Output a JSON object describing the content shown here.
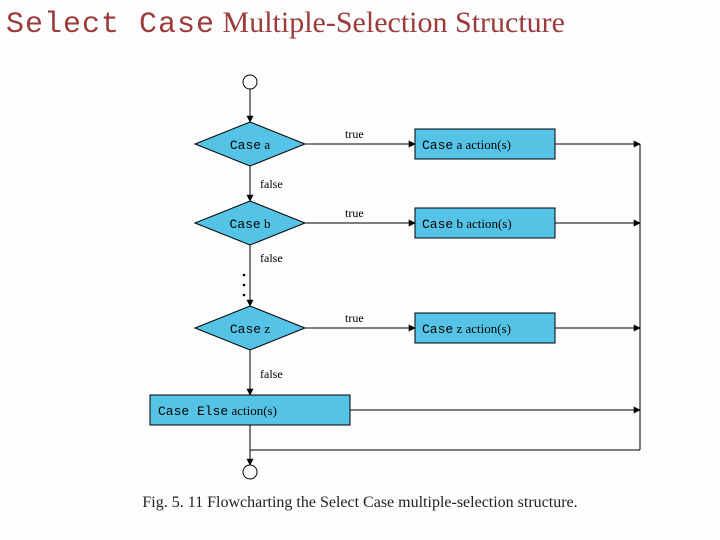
{
  "title": {
    "keyword": "Select Case",
    "rest": " Multiple-Selection Structure"
  },
  "labels": {
    "true": "true",
    "false": "false"
  },
  "diamonds": {
    "a": {
      "kw": "Case",
      "arg": " a"
    },
    "b": {
      "kw": "Case",
      "arg": " b"
    },
    "z": {
      "kw": "Case",
      "arg": " z"
    }
  },
  "actions": {
    "a": {
      "kw": "Case",
      "rest": " a action(s)"
    },
    "b": {
      "kw": "Case",
      "rest": " b action(s)"
    },
    "z": {
      "kw": "Case",
      "rest": " z action(s)"
    },
    "else": {
      "kw": "Case Else",
      "rest": " action(s)"
    }
  },
  "caption": "Fig. 5. 11   Flowcharting the Select Case multiple-selection structure.",
  "colors": {
    "diamond_fill": "#55c3e6",
    "box_fill": "#55c3e6",
    "stroke": "#000000"
  }
}
